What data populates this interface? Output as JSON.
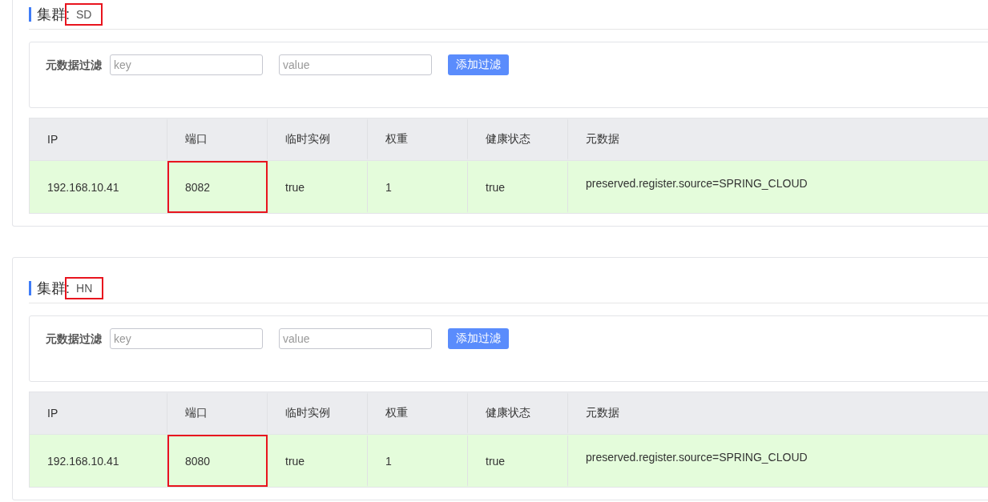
{
  "clusters": [
    {
      "title": "集群:",
      "name": "SD",
      "name_highlighted": true,
      "filter": {
        "label": "元数据过滤",
        "key_placeholder": "key",
        "value_placeholder": "value",
        "button": "添加过滤"
      },
      "table": {
        "columns": [
          "IP",
          "端口",
          "临时实例",
          "权重",
          "健康状态",
          "元数据"
        ],
        "rows": [
          {
            "cells": [
              {
                "text": "192.168.10.41",
                "highlighted": false
              },
              {
                "text": "8082",
                "highlighted": true
              },
              {
                "text": "true",
                "highlighted": false
              },
              {
                "text": "1",
                "highlighted": false
              },
              {
                "text": "true",
                "highlighted": false
              },
              {
                "text": "preserved.register.source=SPRING_CLOUD",
                "highlighted": false
              }
            ]
          }
        ]
      }
    },
    {
      "title": "集群:",
      "name": "HN",
      "name_highlighted": true,
      "filter": {
        "label": "元数据过滤",
        "key_placeholder": "key",
        "value_placeholder": "value",
        "button": "添加过滤"
      },
      "table": {
        "columns": [
          "IP",
          "端口",
          "临时实例",
          "权重",
          "健康状态",
          "元数据"
        ],
        "rows": [
          {
            "cells": [
              {
                "text": "192.168.10.41",
                "highlighted": false
              },
              {
                "text": "8080",
                "highlighted": true
              },
              {
                "text": "true",
                "highlighted": false
              },
              {
                "text": "1",
                "highlighted": false
              },
              {
                "text": "true",
                "highlighted": false
              },
              {
                "text": "preserved.register.source=SPRING_CLOUD",
                "highlighted": false
              }
            ]
          }
        ]
      }
    }
  ]
}
